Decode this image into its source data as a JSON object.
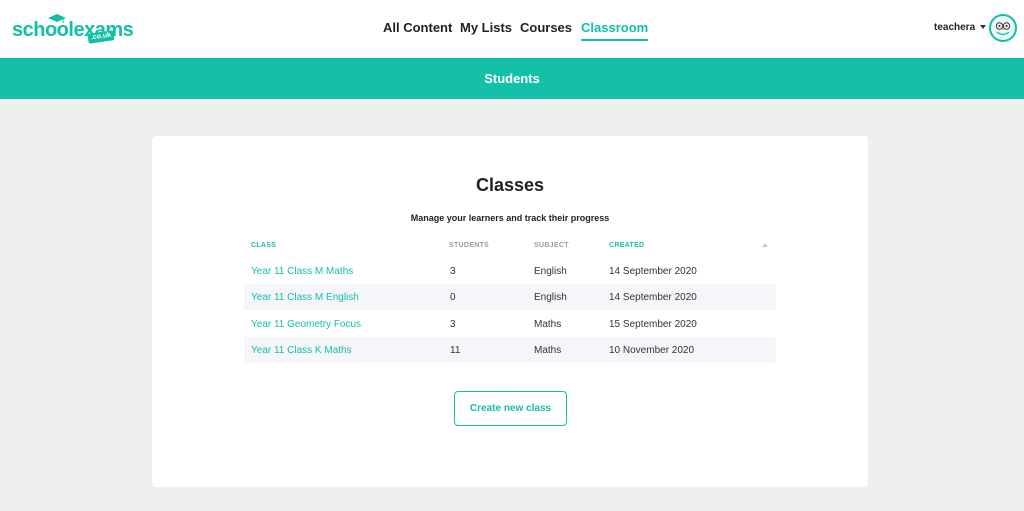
{
  "brand": {
    "name": "schoolexams",
    "badge": ".co.uk"
  },
  "nav": [
    {
      "label": "All Content"
    },
    {
      "label": "My Lists"
    },
    {
      "label": "Courses"
    },
    {
      "label": "Classroom"
    }
  ],
  "user": {
    "name": "teachera",
    "avatar_icon": "owl-icon"
  },
  "banner": {
    "title": "Students"
  },
  "classes": {
    "title": "Classes",
    "subtitle": "Manage your learners and track their progress",
    "columns": [
      "CLASS",
      "STUDENTS",
      "SUBJECT",
      "CREATED"
    ],
    "sorted_column": "CREATED",
    "rows": [
      {
        "class": "Year 11 Class M Maths",
        "students": "3",
        "subject": "English",
        "created": "14 September 2020"
      },
      {
        "class": "Year 11 Class M English",
        "students": "0",
        "subject": "English",
        "created": "14 September 2020"
      },
      {
        "class": "Year 11 Geometry Focus",
        "students": "3",
        "subject": "Maths",
        "created": "15 September 2020"
      },
      {
        "class": "Year 11 Class K Maths",
        "students": "11",
        "subject": "Maths",
        "created": "10 November 2020"
      }
    ],
    "create_button": "Create new class"
  },
  "colors": {
    "accent": "#13bfa6",
    "banner": "#14c0a8",
    "background": "#efefef"
  }
}
